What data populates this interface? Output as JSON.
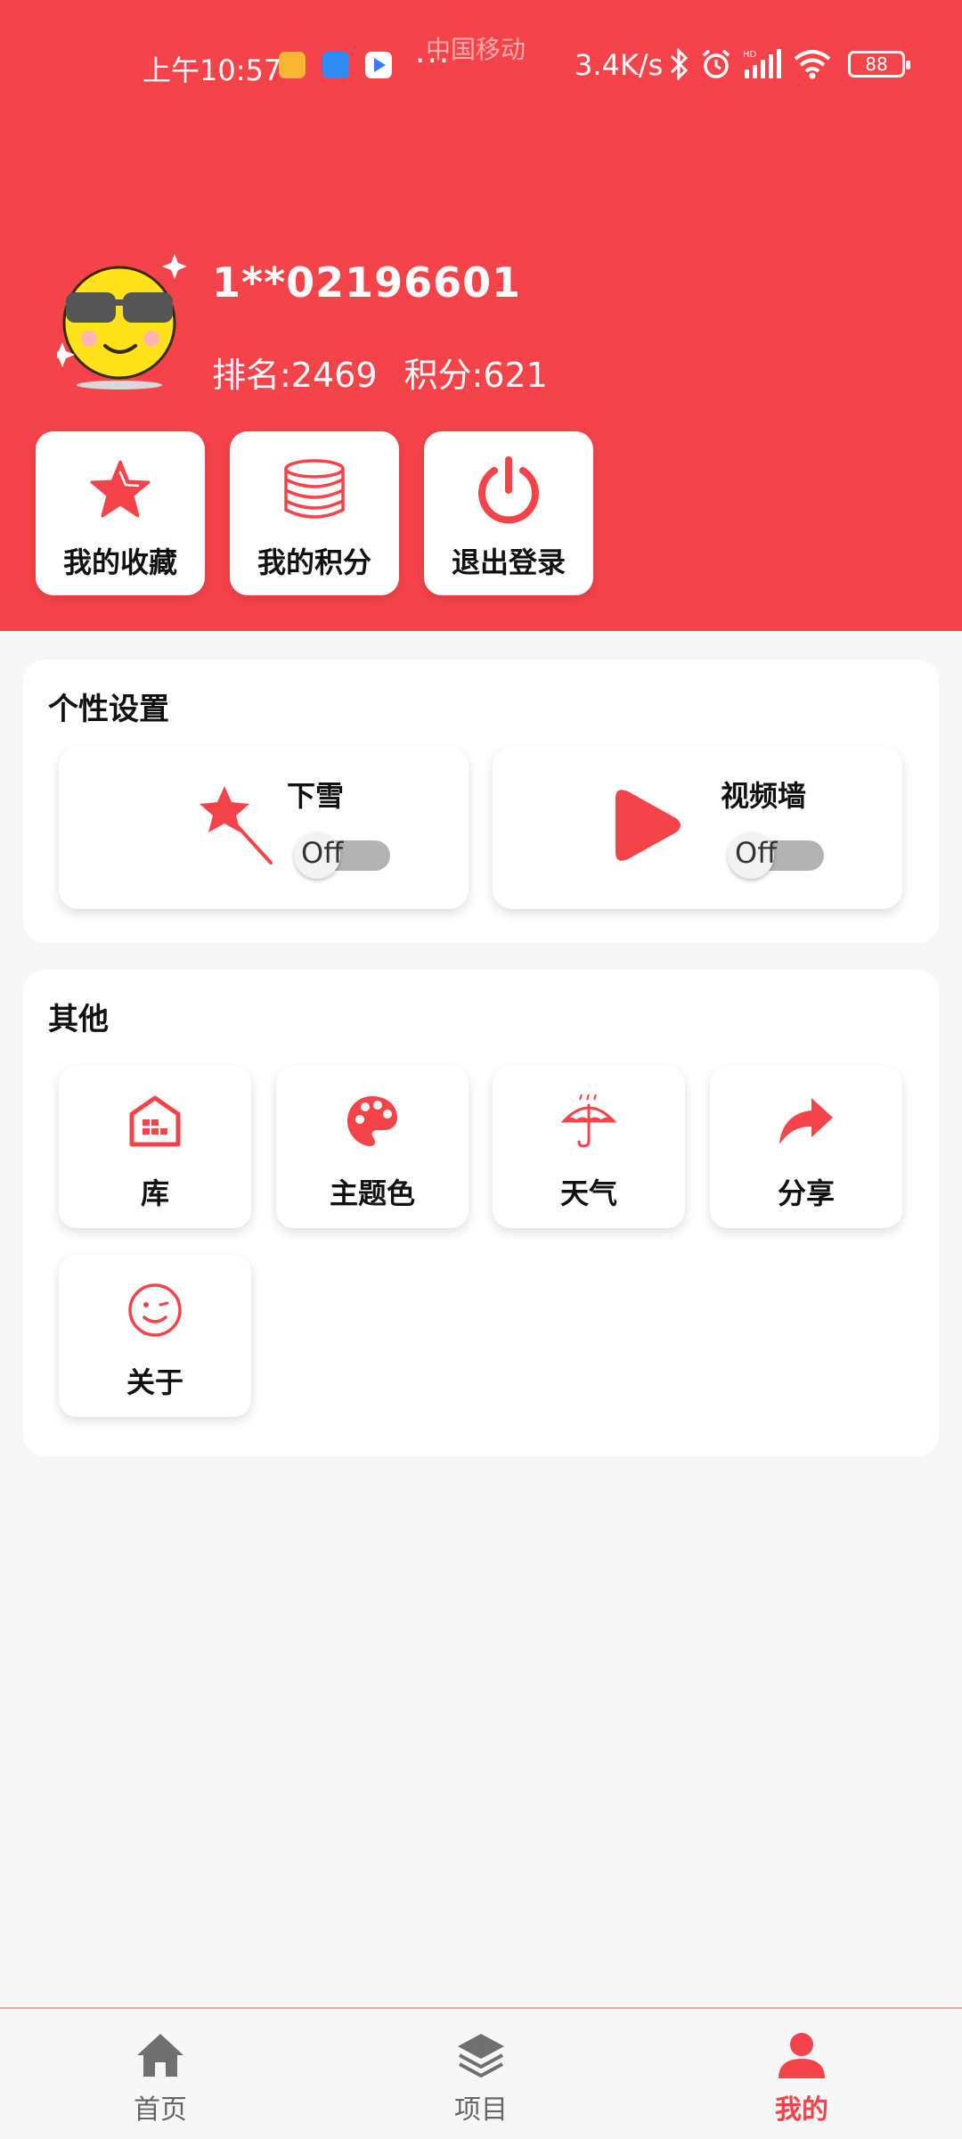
{
  "status_bar": {
    "time": "上午10:57",
    "carrier": "中国移动",
    "more": "···",
    "net_speed": "3.4K/s",
    "battery": "88",
    "icons": [
      "bluetooth-icon",
      "alarm-icon",
      "signal-hd-icon",
      "wifi-icon",
      "battery-icon"
    ]
  },
  "profile": {
    "username": "1**02196601",
    "rank": "排名:2469",
    "points": "积分:621"
  },
  "quick_actions": [
    {
      "label": "我的收藏",
      "icon": "star-icon"
    },
    {
      "label": "我的积分",
      "icon": "coins-icon"
    },
    {
      "label": "退出登录",
      "icon": "power-icon"
    }
  ],
  "personal_settings": {
    "title": "个性设置",
    "toggles": [
      {
        "label": "下雪",
        "state": "Off",
        "icon": "magic-wand-icon"
      },
      {
        "label": "视频墙",
        "state": "Off",
        "icon": "play-icon"
      }
    ]
  },
  "others": {
    "title": "其他",
    "items": [
      {
        "label": "库",
        "icon": "warehouse-icon"
      },
      {
        "label": "主题色",
        "icon": "palette-icon"
      },
      {
        "label": "天气",
        "icon": "umbrella-icon"
      },
      {
        "label": "分享",
        "icon": "share-icon"
      },
      {
        "label": "关于",
        "icon": "smile-icon"
      }
    ]
  },
  "bottom_nav": {
    "items": [
      {
        "label": "首页",
        "icon": "home-icon"
      },
      {
        "label": "项目",
        "icon": "layers-icon"
      },
      {
        "label": "我的",
        "icon": "person-icon",
        "active": true
      }
    ]
  },
  "colors": {
    "brand": "#f4444a",
    "inactive_nav": "#666666",
    "switch_track": "#b3b3b3"
  }
}
